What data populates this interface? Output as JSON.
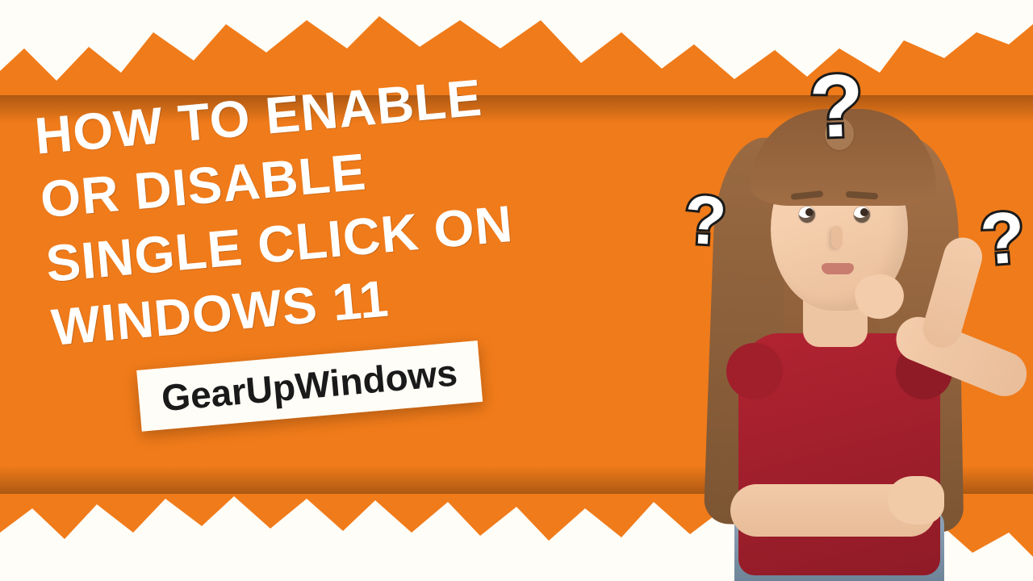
{
  "title": {
    "line1": "HOW TO ENABLE",
    "line2": "OR DISABLE",
    "line3": "SINGLE CLICK ON",
    "line4": "WINDOWS 11"
  },
  "brand": "GearUpWindows",
  "question_marks": [
    "?",
    "?",
    "?"
  ],
  "colors": {
    "background": "#f07b1a",
    "title_text": "#ffffff",
    "brand_bg": "#fffdf7",
    "brand_text": "#1a1a1a",
    "shirt": "#b22331"
  }
}
